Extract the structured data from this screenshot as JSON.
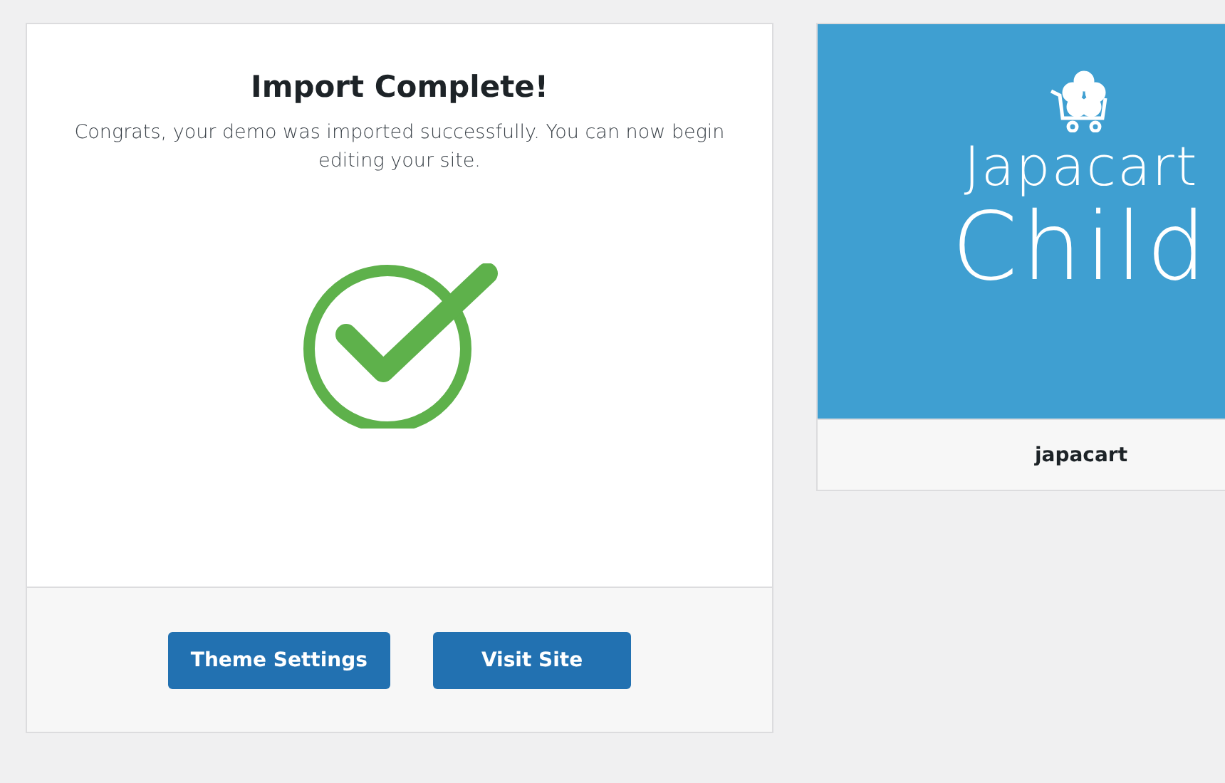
{
  "import_dialog": {
    "title": "Import Complete!",
    "message": "Congrats, your demo was imported successfully. You can now begin editing your site.",
    "buttons": [
      "Theme Settings",
      "Visit Site"
    ]
  },
  "theme_card": {
    "logo_lines": [
      "Japacart",
      "Child"
    ],
    "name": "japacart"
  }
}
